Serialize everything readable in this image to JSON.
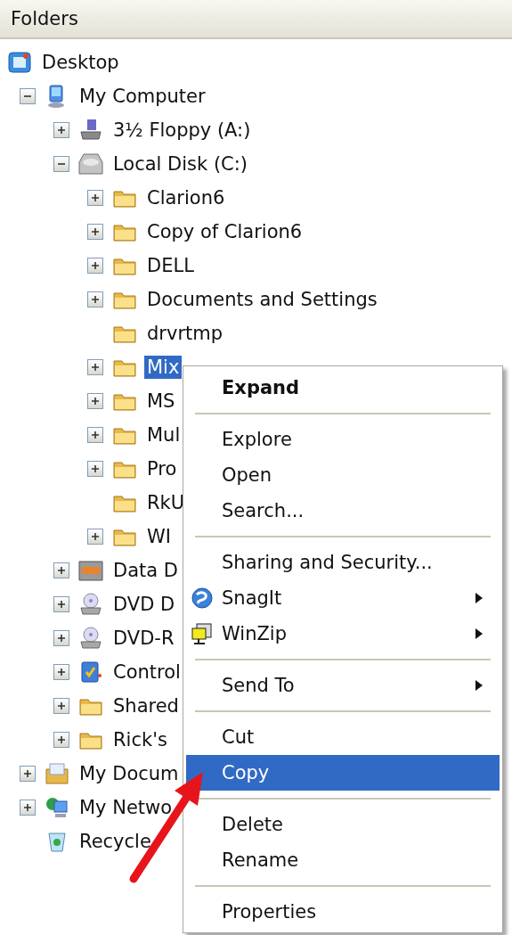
{
  "panel": {
    "title": "Folders"
  },
  "tree": [
    {
      "label": "Desktop",
      "kind": "desktop",
      "selected": false,
      "children": [
        {
          "label": "My Computer",
          "kind": "computer",
          "expanded": true,
          "selected": false,
          "children": [
            {
              "label": "3½ Floppy (A:)",
              "kind": "floppy",
              "expanded": false,
              "selected": false
            },
            {
              "label": "Local Disk (C:)",
              "kind": "disk",
              "expanded": true,
              "selected": false,
              "children": [
                {
                  "label": "Clarion6",
                  "kind": "folder",
                  "expanded": false,
                  "selected": false
                },
                {
                  "label": "Copy of Clarion6",
                  "kind": "folder",
                  "expanded": false,
                  "selected": false
                },
                {
                  "label": "DELL",
                  "kind": "folder",
                  "expanded": false,
                  "selected": false
                },
                {
                  "label": "Documents and Settings",
                  "kind": "folder",
                  "expanded": false,
                  "selected": false
                },
                {
                  "label": "drvrtmp",
                  "kind": "folder",
                  "selected": false
                },
                {
                  "label": "Mix",
                  "kind": "folder",
                  "expanded": false,
                  "selected": true
                },
                {
                  "label": "MS",
                  "kind": "folder",
                  "expanded": false,
                  "selected": false
                },
                {
                  "label": "Mul",
                  "kind": "folder",
                  "expanded": false,
                  "selected": false
                },
                {
                  "label": "Pro",
                  "kind": "folder",
                  "expanded": false,
                  "selected": false
                },
                {
                  "label": "RkU",
                  "kind": "folder",
                  "selected": false
                },
                {
                  "label": "WI",
                  "kind": "folder",
                  "expanded": false,
                  "selected": false
                }
              ]
            },
            {
              "label": "Data D",
              "kind": "removable",
              "expanded": false,
              "selected": false
            },
            {
              "label": "DVD D",
              "kind": "dvd",
              "expanded": false,
              "selected": false
            },
            {
              "label": "DVD-R",
              "kind": "dvd",
              "expanded": false,
              "selected": false
            },
            {
              "label": "Control",
              "kind": "control",
              "expanded": false,
              "selected": false
            },
            {
              "label": "Shared",
              "kind": "folder",
              "expanded": false,
              "selected": false
            },
            {
              "label": "Rick's",
              "kind": "folder",
              "expanded": false,
              "selected": false
            }
          ]
        },
        {
          "label": "My Docum",
          "kind": "documents",
          "expanded": false,
          "selected": false
        },
        {
          "label": "My Netwo",
          "kind": "network",
          "expanded": false,
          "selected": false
        },
        {
          "label": "Recycle",
          "kind": "recycle",
          "selected": false
        }
      ]
    }
  ],
  "context_menu": {
    "items": [
      {
        "kind": "item",
        "label": "Expand",
        "bold": true,
        "selected": false
      },
      {
        "kind": "separator"
      },
      {
        "kind": "item",
        "label": "Explore",
        "selected": false
      },
      {
        "kind": "item",
        "label": "Open",
        "selected": false
      },
      {
        "kind": "item",
        "label": "Search...",
        "selected": false
      },
      {
        "kind": "separator"
      },
      {
        "kind": "item",
        "label": "Sharing and Security...",
        "selected": false
      },
      {
        "kind": "globe",
        "label": "SnagIt",
        "submenu": true,
        "selected": false
      },
      {
        "kind": "winzip",
        "label": "WinZip",
        "submenu": true,
        "selected": false
      },
      {
        "kind": "separator"
      },
      {
        "kind": "item",
        "label": "Send To",
        "submenu": true,
        "selected": false
      },
      {
        "kind": "separator"
      },
      {
        "kind": "item",
        "label": "Cut",
        "selected": false
      },
      {
        "kind": "item",
        "label": "Copy",
        "selected": true
      },
      {
        "kind": "separator"
      },
      {
        "kind": "item",
        "label": "Delete",
        "selected": false
      },
      {
        "kind": "item",
        "label": "Rename",
        "selected": false
      },
      {
        "kind": "separator"
      },
      {
        "kind": "item",
        "label": "Properties",
        "selected": false
      }
    ]
  }
}
